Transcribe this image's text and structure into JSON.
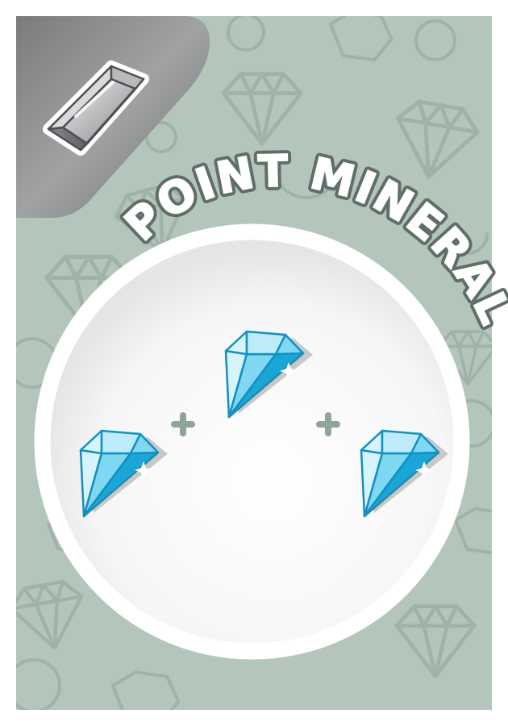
{
  "card": {
    "title": "POINT MINERALS",
    "background_color": "#b4c6bb",
    "pattern_stroke_color": "#9fb3a8",
    "title_fill_color": "#ffffff",
    "title_shadow_color": "#6d7d75"
  },
  "resource": {
    "icon": "silver-bar-icon",
    "badge_color": "#8e8f91"
  },
  "cost": {
    "gem_icon": "diamond-icon",
    "gem_count": 3,
    "separator_icon": "plus-icon",
    "separator_color": "#8ea597",
    "gem_light": "#d7f3fb",
    "gem_mid": "#7fd7f2",
    "gem_dark": "#1aa6d6",
    "gem_outline": "#158fbd"
  }
}
